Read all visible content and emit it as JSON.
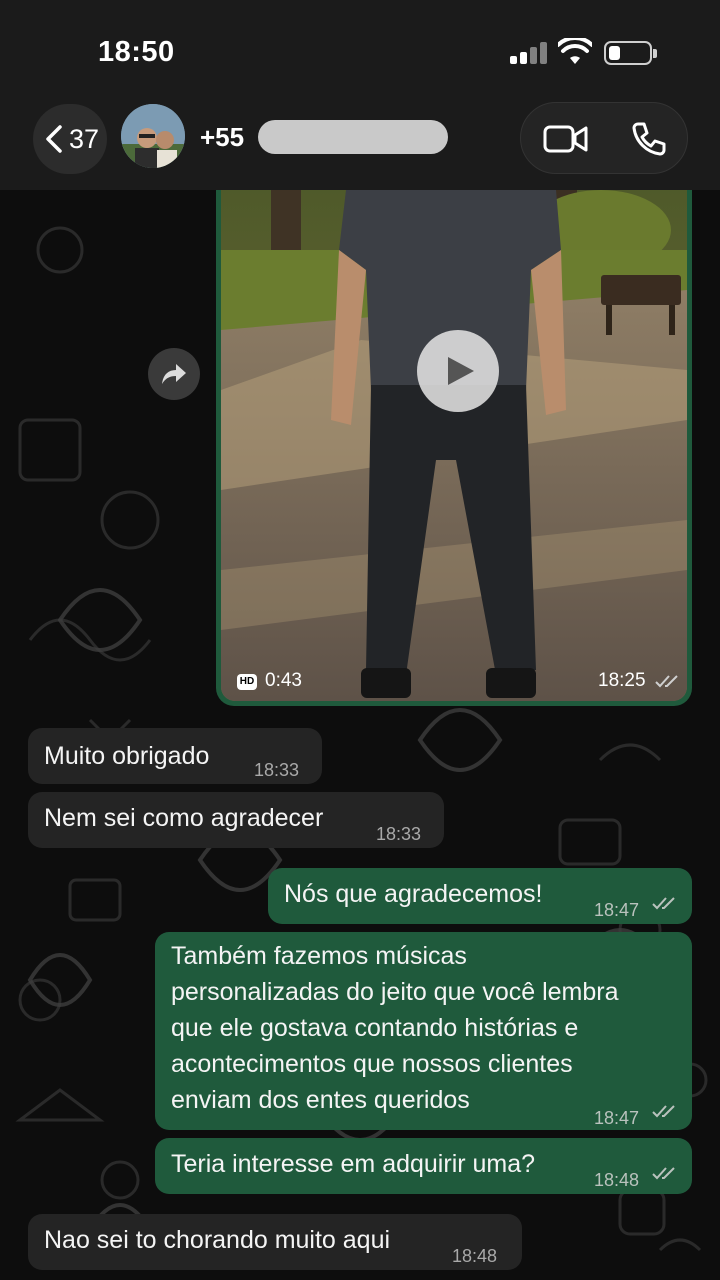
{
  "status_bar": {
    "time": "18:50"
  },
  "header": {
    "back_count": "37",
    "contact_name": "+55",
    "icons": [
      "back-chevron-icon",
      "video-call-icon",
      "voice-call-icon"
    ]
  },
  "video_message": {
    "badge": "HD",
    "duration": "0:43",
    "time": "18:25",
    "status": "read"
  },
  "messages": [
    {
      "direction": "incoming",
      "text": "Muito obrigado",
      "time": "18:33"
    },
    {
      "direction": "incoming",
      "text": "Nem sei como agradecer",
      "time": "18:33"
    },
    {
      "direction": "outgoing",
      "text": "Nós que agradecemos!",
      "time": "18:47",
      "status": "read"
    },
    {
      "direction": "outgoing",
      "text": "Também fazemos músicas\npersonalizadas do jeito que você lembra\nque ele gostava contando histórias e\nacontecimentos que nossos clientes\nenviam dos entes queridos",
      "time": "18:47",
      "status": "read"
    },
    {
      "direction": "outgoing",
      "text": "Teria interesse em adquirir uma?",
      "time": "18:48",
      "status": "read"
    },
    {
      "direction": "incoming",
      "text": "Nao sei to chorando muito aqui",
      "time": "18:48"
    }
  ],
  "colors": {
    "outgoing_bubble": "#1f5a3c",
    "incoming_bubble": "#242424",
    "background": "#0d0d0d",
    "header": "#1b1b1b"
  }
}
